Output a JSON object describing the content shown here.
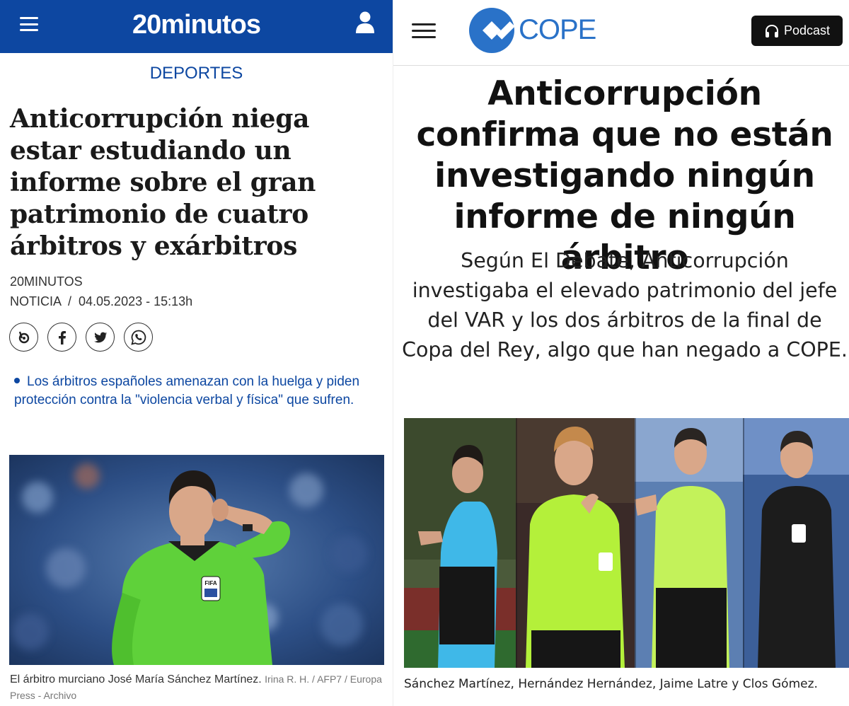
{
  "left": {
    "brand": "20minutos",
    "section": "DEPORTES",
    "headline": "Anticorrupción niega estar estudiando un informe sobre el gran patrimonio de cuatro árbitros y exárbitros",
    "author": "20MINUTOS",
    "meta": "NOTICIA  /  04.05.2023 - 15:13h",
    "share_icons": [
      "bluesky-icon",
      "facebook-icon",
      "twitter-icon",
      "whatsapp-icon"
    ],
    "related_link": "Los árbitros españoles amenazan con la huelga y piden protección contra la \"violencia verbal y física\" que sufren.",
    "photo_badge": "FIFA",
    "caption": "El árbitro murciano José María Sánchez Martínez.",
    "credit": "Irina R. H. / AFP7 / Europa Press - Archivo",
    "colors": {
      "brand_blue": "#0d47a1",
      "referee_shirt": "#5fd13a"
    }
  },
  "right": {
    "brand": "COPE",
    "podcast_label": "Podcast",
    "headline": "Anticorrupción confirma que no están investigando ningún informe de ningún árbitro",
    "subheadline": "Según El Debate, Anticorrupción investigaba el elevado patrimonio del jefe del VAR y los dos árbitros de la final de Copa del Rey, algo que han negado a COPE.",
    "caption": "Sánchez Martínez, Hernández Hernández, Jaime Latre y Clos Gómez.",
    "colors": {
      "cope_blue": "#2a72c8",
      "podcast_bg": "#111111"
    }
  }
}
